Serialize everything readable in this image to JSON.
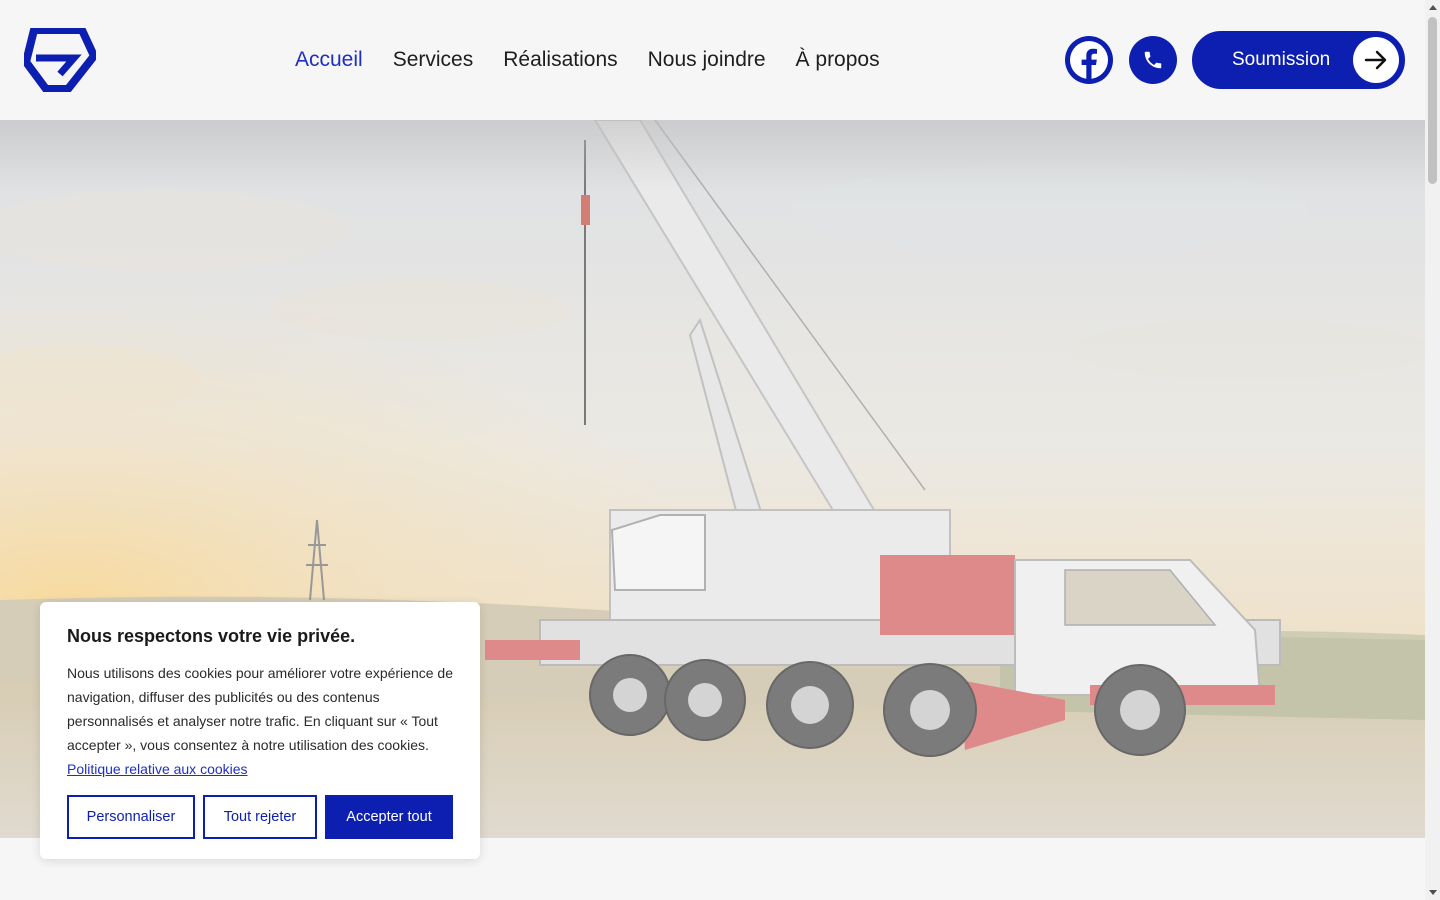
{
  "header": {
    "logo_icon": "brand-logo-icon",
    "nav": [
      {
        "label": "Accueil",
        "active": true
      },
      {
        "label": "Services",
        "active": false
      },
      {
        "label": "Réalisations",
        "active": false
      },
      {
        "label": "Nous joindre",
        "active": false
      },
      {
        "label": "À propos",
        "active": false
      }
    ],
    "facebook_icon": "facebook-icon",
    "phone_icon": "phone-icon",
    "quote_button": "Soumission",
    "quote_icon": "arrow-right-icon"
  },
  "hero": {
    "image": "mobile-crane-at-sunset"
  },
  "cookie_banner": {
    "title": "Nous respectons votre vie privée.",
    "text": "Nous utilisons des cookies pour améliorer votre expérience de navigation, diffuser des publicités ou des contenus personnalisés et analyser notre trafic. En cliquant sur « Tout accepter », vous consentez à notre utilisation des cookies.",
    "policy_link": "Politique relative aux cookies",
    "customize_button": "Personnaliser",
    "reject_button": "Tout rejeter",
    "accept_button": "Accepter tout"
  },
  "colors": {
    "brand": "#0d1fb0",
    "nav_active": "#1f2fc4",
    "background": "#f6f6f6"
  }
}
